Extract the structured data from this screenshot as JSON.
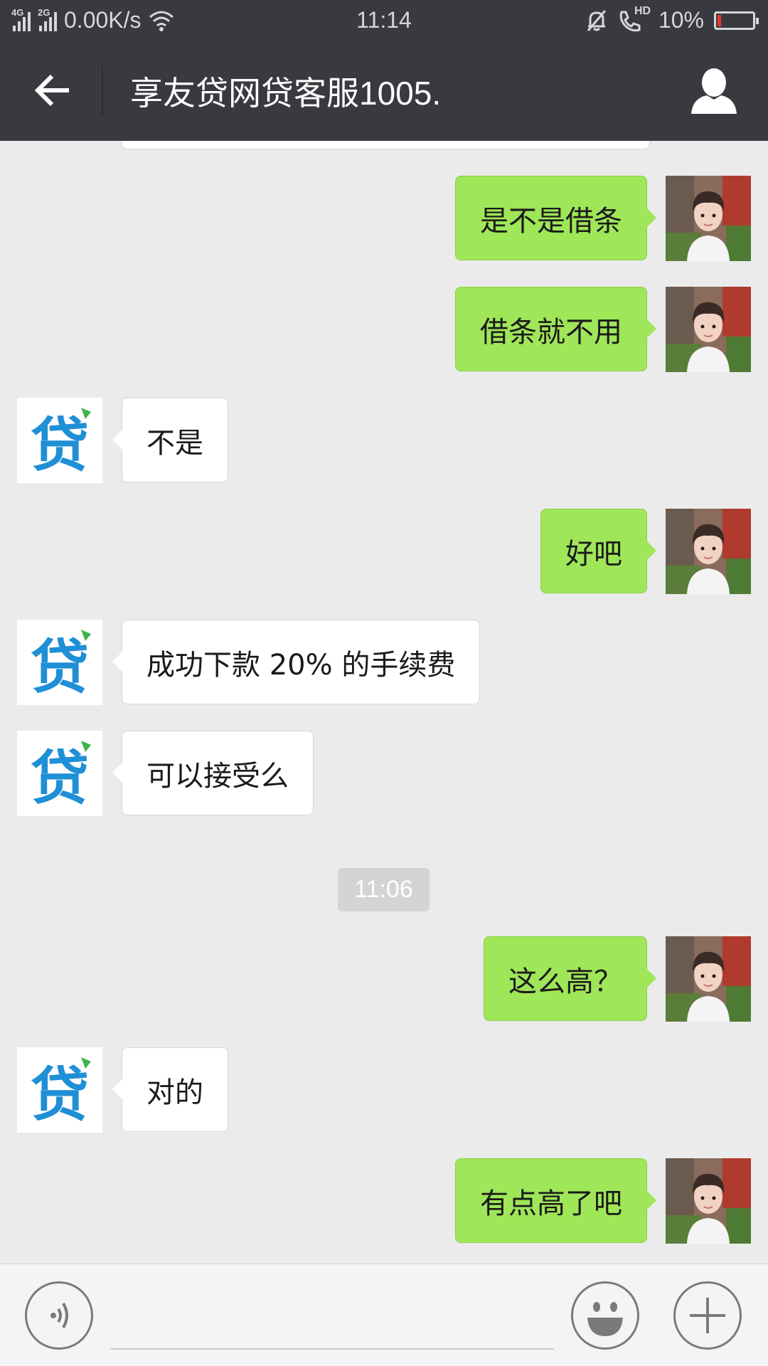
{
  "status_bar": {
    "network_1": "4G",
    "network_2": "2G",
    "speed": "0.00K/s",
    "time": "11:14",
    "call_label": "HD",
    "battery": "10%",
    "battery_level": 0.1,
    "battery_color": "#e8362b"
  },
  "header": {
    "title": "享友贷网贷客服1005.",
    "back_icon": "arrow-left-icon",
    "profile_icon": "user-icon"
  },
  "colors": {
    "header_bg": "#393a3f",
    "chat_bg": "#ebebeb",
    "sent_bubble": "#9fe658",
    "received_bubble": "#ffffff",
    "logo_blue": "#1f8fd6",
    "logo_green": "#3cb44a"
  },
  "messages": [
    {
      "from": "me",
      "text": "是不是借条"
    },
    {
      "from": "me",
      "text": "借条就不用"
    },
    {
      "from": "agent",
      "text": "不是"
    },
    {
      "from": "me",
      "text": "好吧"
    },
    {
      "from": "agent",
      "text": "成功下款 20% 的手续费"
    },
    {
      "from": "agent",
      "text": "可以接受么"
    },
    {
      "type": "time",
      "text": "11:06"
    },
    {
      "from": "me",
      "text": "这么高？"
    },
    {
      "from": "agent",
      "text": "对的"
    },
    {
      "from": "me",
      "text": "有点高了吧"
    }
  ],
  "agent_avatar": {
    "glyph": "贷"
  },
  "input_bar": {
    "voice_icon": "voice-icon",
    "emoji_icon": "smiley-icon",
    "plus_icon": "plus-icon",
    "value": ""
  }
}
